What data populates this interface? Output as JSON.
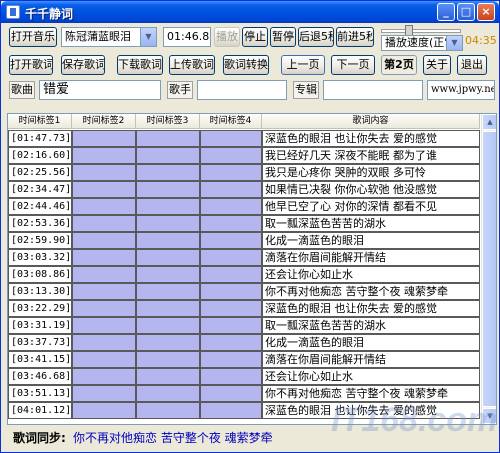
{
  "window": {
    "title": "千千静词"
  },
  "toolbar1": {
    "open_music": "打开音乐",
    "song_select": "陈冠蒲蓝眼泪",
    "time_display": "01:46.87",
    "play": "播放",
    "stop": "停止",
    "pause": "暂停",
    "back5": "后退5秒",
    "forward5": "前进5秒",
    "speed_select": "播放速度(正常)",
    "clock": "04:35"
  },
  "toolbar2": {
    "open_lyrics": "打开歌词",
    "save_lyrics": "保存歌词",
    "download_lyrics": "下载歌词",
    "upload_lyrics": "上传歌词",
    "convert_lyrics": "歌词转换",
    "prev_page": "上一页",
    "next_page": "下一页",
    "page_indicator": "第2页",
    "about": "关于",
    "exit": "退出"
  },
  "meta": {
    "song_label": "歌曲",
    "song_value": "错爱",
    "singer_label": "歌手",
    "singer_value": "",
    "album_label": "专辑",
    "album_value": "",
    "url": "www.jpwy.net"
  },
  "table": {
    "headers": [
      "时间标签1",
      "时间标签2",
      "时间标签3",
      "时间标签4",
      "歌词内容"
    ],
    "rows": [
      {
        "time": "[01:47.73]",
        "lyric": "深蓝色的眼泪 也让你失去 爱的感觉"
      },
      {
        "time": "[02:16.60]",
        "lyric": "我已经好几天 深夜不能眠 都为了谁"
      },
      {
        "time": "[02:25.56]",
        "lyric": "我只是心疼你 哭肿的双眼 多可怜"
      },
      {
        "time": "[02:34.47]",
        "lyric": "如果情已决裂 你你心软弛 他没感觉"
      },
      {
        "time": "[02:44.46]",
        "lyric": "他早已空了心 对你的深情 都看不见"
      },
      {
        "time": "[02:53.36]",
        "lyric": "取一瓢深蓝色苦苦的湖水"
      },
      {
        "time": "[02:59.90]",
        "lyric": "化成一滴蓝色的眼泪"
      },
      {
        "time": "[03:03.32]",
        "lyric": "滴落在你眉间能解开情结"
      },
      {
        "time": "[03:08.86]",
        "lyric": "还会让你心如止水"
      },
      {
        "time": "[03:13.30]",
        "lyric": "你不再对他痴恋 苦守整个夜 魂萦梦牵"
      },
      {
        "time": "[03:22.29]",
        "lyric": "深蓝色的眼泪 也让你失去 爱的感觉"
      },
      {
        "time": "[03:31.19]",
        "lyric": "取一瓢深蓝色苦苦的湖水"
      },
      {
        "time": "[03:37.73]",
        "lyric": "化成一滴蓝色的眼泪"
      },
      {
        "time": "[03:41.15]",
        "lyric": "滴落在你眉间能解开情结"
      },
      {
        "time": "[03:46.68]",
        "lyric": "还会让你心如止水"
      },
      {
        "time": "[03:51.13]",
        "lyric": "你不再对他痴恋 苦守整个夜 魂萦梦牵"
      },
      {
        "time": "[04:01.12]",
        "lyric": "深蓝色的眼泪 也让你失去 爱的感觉"
      }
    ]
  },
  "sync": {
    "label": "歌词同步:",
    "text": "你不再对他痴恋 苦守整个夜 魂萦梦牵"
  },
  "watermark": "IT168.com"
}
